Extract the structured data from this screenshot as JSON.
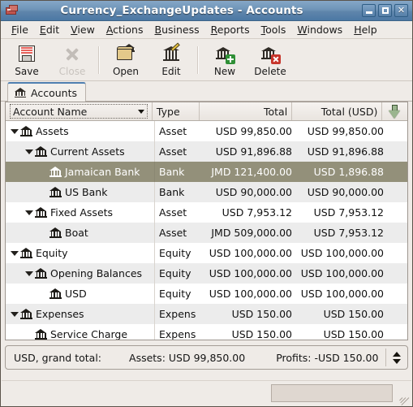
{
  "window": {
    "title": "Currency_ExchangeUpdates - Accounts",
    "app_icon": "wallet-icon",
    "controls": {
      "minimize": "minimize-icon",
      "maximize": "maximize-icon",
      "close": "close-icon"
    },
    "titlebar_color": "#4c78a4"
  },
  "menubar": {
    "items": [
      {
        "label": "File",
        "mnemonic": "F"
      },
      {
        "label": "Edit",
        "mnemonic": "E"
      },
      {
        "label": "View",
        "mnemonic": "V"
      },
      {
        "label": "Actions",
        "mnemonic": "A"
      },
      {
        "label": "Business",
        "mnemonic": "B"
      },
      {
        "label": "Reports",
        "mnemonic": "R"
      },
      {
        "label": "Tools",
        "mnemonic": "T"
      },
      {
        "label": "Windows",
        "mnemonic": "W"
      },
      {
        "label": "Help",
        "mnemonic": "H"
      }
    ]
  },
  "toolbar": {
    "buttons": [
      {
        "label": "Save",
        "icon": "floppy-disk-icon",
        "enabled": true
      },
      {
        "label": "Close",
        "icon": "close-x-icon",
        "enabled": false
      },
      {
        "label": "Open",
        "icon": "open-folder-icon",
        "enabled": true
      },
      {
        "label": "Edit",
        "icon": "edit-pencil-icon",
        "enabled": true
      },
      {
        "label": "New",
        "icon": "new-account-plus-icon",
        "enabled": true
      },
      {
        "label": "Delete",
        "icon": "delete-account-x-icon",
        "enabled": true
      }
    ]
  },
  "tabs": [
    {
      "label": "Accounts",
      "icon": "bank-icon",
      "active": true
    }
  ],
  "accounts_tree": {
    "columns": [
      {
        "key": "name",
        "label": "Account Name",
        "sort_indicator": "chevron-down-icon"
      },
      {
        "key": "type",
        "label": "Type"
      },
      {
        "key": "total",
        "label": "Total"
      },
      {
        "key": "totalusd",
        "label": "Total (USD)"
      }
    ],
    "column_options_icon": "green-down-arrow-icon",
    "rows": [
      {
        "name": "Assets",
        "depth": 0,
        "expander": "expanded",
        "type": "Asset",
        "total": "USD 99,850.00",
        "total_usd": "USD 99,850.00",
        "selected": false
      },
      {
        "name": "Current Assets",
        "depth": 1,
        "expander": "expanded",
        "type": "Asset",
        "total": "USD 91,896.88",
        "total_usd": "USD 91,896.88",
        "selected": false
      },
      {
        "name": "Jamaican Bank",
        "depth": 2,
        "expander": "none",
        "type": "Bank",
        "total": "JMD 121,400.00",
        "total_usd": "USD 1,896.88",
        "selected": true
      },
      {
        "name": "US Bank",
        "depth": 2,
        "expander": "none",
        "type": "Bank",
        "total": "USD 90,000.00",
        "total_usd": "USD 90,000.00",
        "selected": false
      },
      {
        "name": "Fixed Assets",
        "depth": 1,
        "expander": "expanded",
        "type": "Asset",
        "total": "USD 7,953.12",
        "total_usd": "USD 7,953.12",
        "selected": false
      },
      {
        "name": "Boat",
        "depth": 2,
        "expander": "none",
        "type": "Asset",
        "total": "JMD 509,000.00",
        "total_usd": "USD 7,953.12",
        "selected": false
      },
      {
        "name": "Equity",
        "depth": 0,
        "expander": "expanded",
        "type": "Equity",
        "total": "USD 100,000.00",
        "total_usd": "USD 100,000.00",
        "selected": false
      },
      {
        "name": "Opening Balances",
        "depth": 1,
        "expander": "expanded",
        "type": "Equity",
        "total": "USD 100,000.00",
        "total_usd": "USD 100,000.00",
        "selected": false
      },
      {
        "name": "USD",
        "depth": 2,
        "expander": "none",
        "type": "Equity",
        "total": "USD 100,000.00",
        "total_usd": "USD 100,000.00",
        "selected": false
      },
      {
        "name": "Expenses",
        "depth": 0,
        "expander": "expanded",
        "type": "Expens",
        "total": "USD 150.00",
        "total_usd": "USD 150.00",
        "selected": false
      },
      {
        "name": "Service Charge",
        "depth": 1,
        "expander": "none",
        "type": "Expens",
        "total": "USD 150.00",
        "total_usd": "USD 150.00",
        "selected": false
      }
    ],
    "selection_color": "#93907a"
  },
  "summary_bar": {
    "label": "USD, grand total:",
    "assets": "Assets: USD 99,850.00",
    "profits": "Profits: -USD 150.00",
    "spinner_icon": "up-down-spinner-icon"
  },
  "statusbar": {
    "resize_grip": "resize-grip-icon"
  }
}
